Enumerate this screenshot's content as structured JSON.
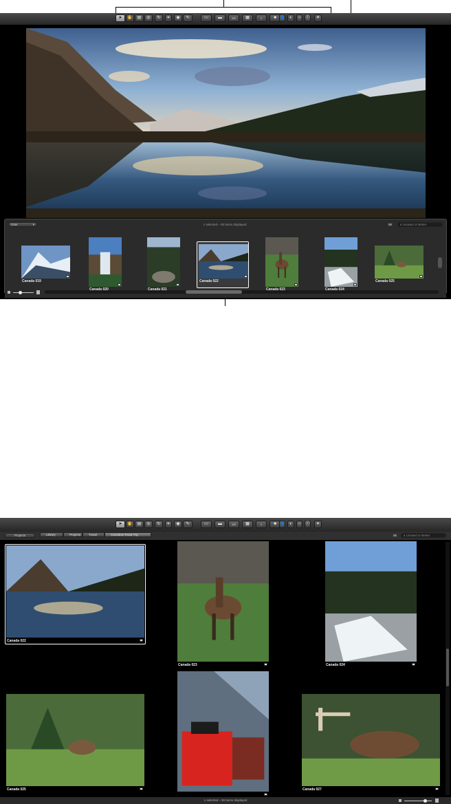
{
  "toolbar": {
    "buttons": [
      {
        "icon": "pointer-icon",
        "selected": true
      },
      {
        "icon": "hand-icon"
      },
      {
        "icon": "stack-icon"
      },
      {
        "icon": "loupe-icon"
      },
      {
        "icon": "rotate-icon"
      },
      {
        "icon": "crop-icon"
      },
      {
        "icon": "red-eye-icon"
      },
      {
        "icon": "brush-icon"
      },
      {
        "icon": "viewer-icon"
      },
      {
        "icon": "split-icon"
      },
      {
        "icon": "multi-view-icon",
        "text": "2/3"
      },
      {
        "icon": "browser-icon"
      },
      {
        "icon": "single-view-icon",
        "text": "1"
      },
      {
        "icon": "fullscreen-icon"
      },
      {
        "icon": "inspector-icon"
      },
      {
        "icon": "adjustments-icon"
      },
      {
        "icon": "lift-icon"
      },
      {
        "icon": "info-icon"
      },
      {
        "icon": "hud-icon"
      }
    ]
  },
  "top": {
    "browser": {
      "sort_label": "Date",
      "status": "1 selected – 50 items displayed",
      "search_placeholder": "Unrated or Better",
      "thumbs": [
        {
          "label": "Canada 019"
        },
        {
          "label": "Canada 020"
        },
        {
          "label": "Canada 021"
        },
        {
          "label": "Canada 022",
          "selected": true
        },
        {
          "label": "Canada 023"
        },
        {
          "label": "Canada 024"
        },
        {
          "label": "Canada 025"
        }
      ]
    }
  },
  "bottom": {
    "path": {
      "projects_button": "Projects",
      "crumbs": [
        "Library",
        "Projects",
        "Travel",
        "Canadian Road Trip"
      ]
    },
    "search_placeholder": "Unrated or Better",
    "grid": [
      {
        "label": "Canada 022",
        "selected": true
      },
      {
        "label": "Canada 023"
      },
      {
        "label": "Canada 024"
      },
      {
        "label": "Canada 025"
      },
      {
        "label": ""
      },
      {
        "label": "Canada 027"
      }
    ],
    "status": "1 selected – 50 items displayed"
  },
  "colors": {
    "panel": "#262626",
    "selection": "#ffffff",
    "sky": "#7fa3cc",
    "mountain": "#4d4236"
  }
}
